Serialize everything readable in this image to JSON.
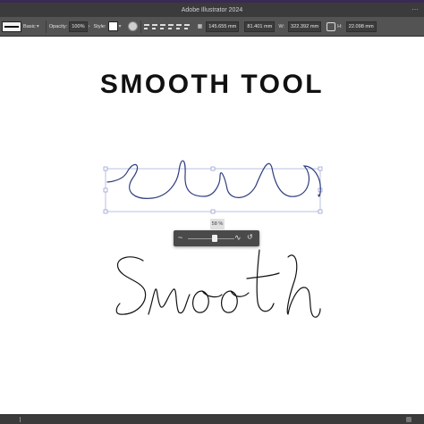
{
  "window": {
    "title": "Adobe Illustrator 2024"
  },
  "control_bar": {
    "stroke_profile": "Basic",
    "opacity_label": "Opacity:",
    "opacity_value": "100%",
    "style_label": "Style:",
    "x_value": "145.655 mm",
    "y_value": "81.401 mm",
    "w_label": "W:",
    "w_value": "322.392 mm",
    "h_label": "H:",
    "h_value": "22.098 mm"
  },
  "artboard": {
    "headline": "SMOOTH TOOL",
    "handwriting_text": "Smooth",
    "colors": {
      "selected_path": "#2f3c7e",
      "bounding_box": "#9aa6d6",
      "ink": "#111111"
    }
  },
  "smooth_panel": {
    "percent_label": "58 %",
    "slider_fraction": 0.58,
    "left_icon": "tilde-icon",
    "right_icon": "wave-icon",
    "reset_icon": "reset-icon"
  }
}
